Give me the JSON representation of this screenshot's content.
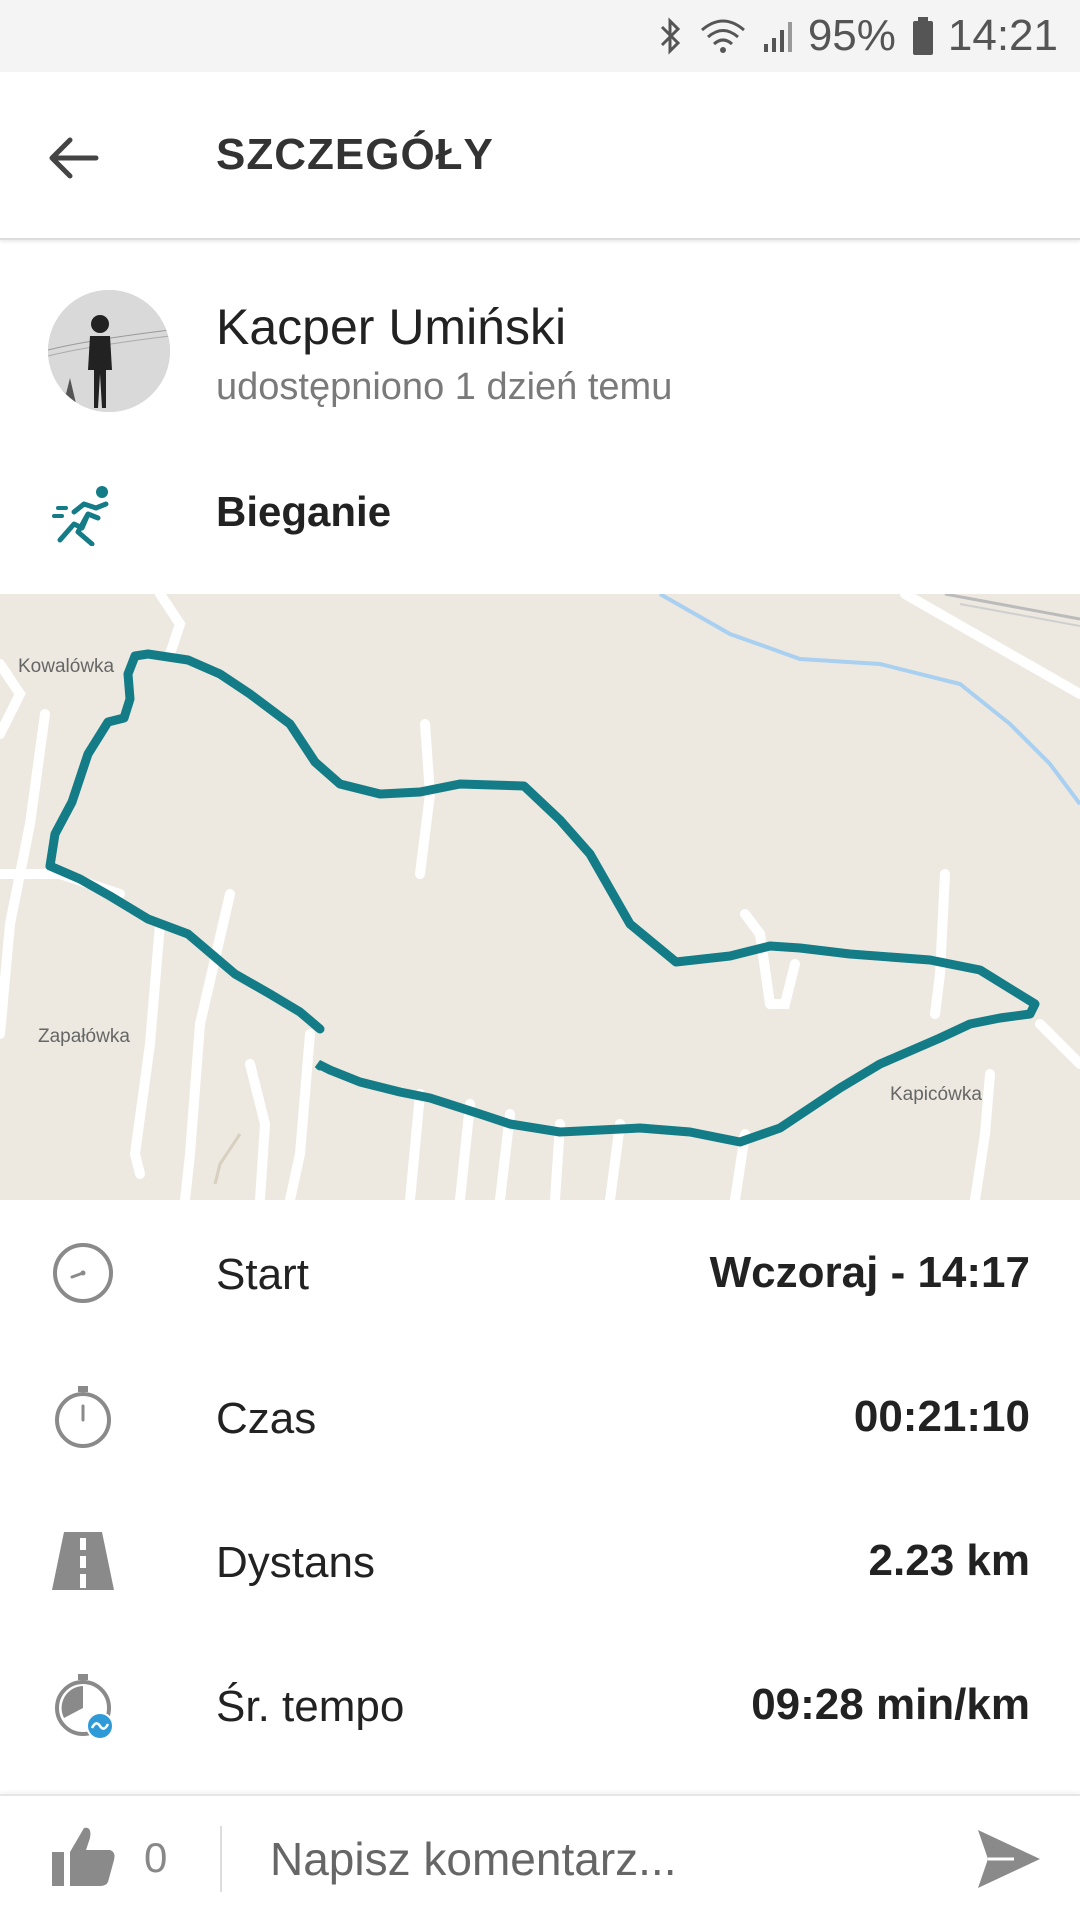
{
  "status_bar": {
    "battery": "95%",
    "time": "14:21",
    "icons": [
      "bluetooth-icon",
      "wifi-icon",
      "signal-icon",
      "battery-icon"
    ]
  },
  "header": {
    "title": "SZCZEGÓŁY",
    "back_icon": "arrow-left-icon"
  },
  "user": {
    "name": "Kacper Umiński",
    "shared": "udostępniono 1 dzień temu"
  },
  "activity": {
    "icon": "running-icon",
    "label": "Bieganie",
    "accent": "#137c87"
  },
  "map": {
    "route_color": "#137c87",
    "places": [
      "Kowalówka",
      "Zapałówka",
      "Kapicówka"
    ]
  },
  "stats": [
    {
      "icon": "clock-icon",
      "label": "Start",
      "value": "Wczoraj - 14:17"
    },
    {
      "icon": "stopwatch-icon",
      "label": "Czas",
      "value": "00:21:10"
    },
    {
      "icon": "road-icon",
      "label": "Dystans",
      "value": "2.23 km"
    },
    {
      "icon": "pace-icon",
      "label": "Śr. tempo",
      "value": "09:28 min/km"
    }
  ],
  "comment_bar": {
    "like_count": "0",
    "placeholder": "Napisz komentarz..."
  }
}
